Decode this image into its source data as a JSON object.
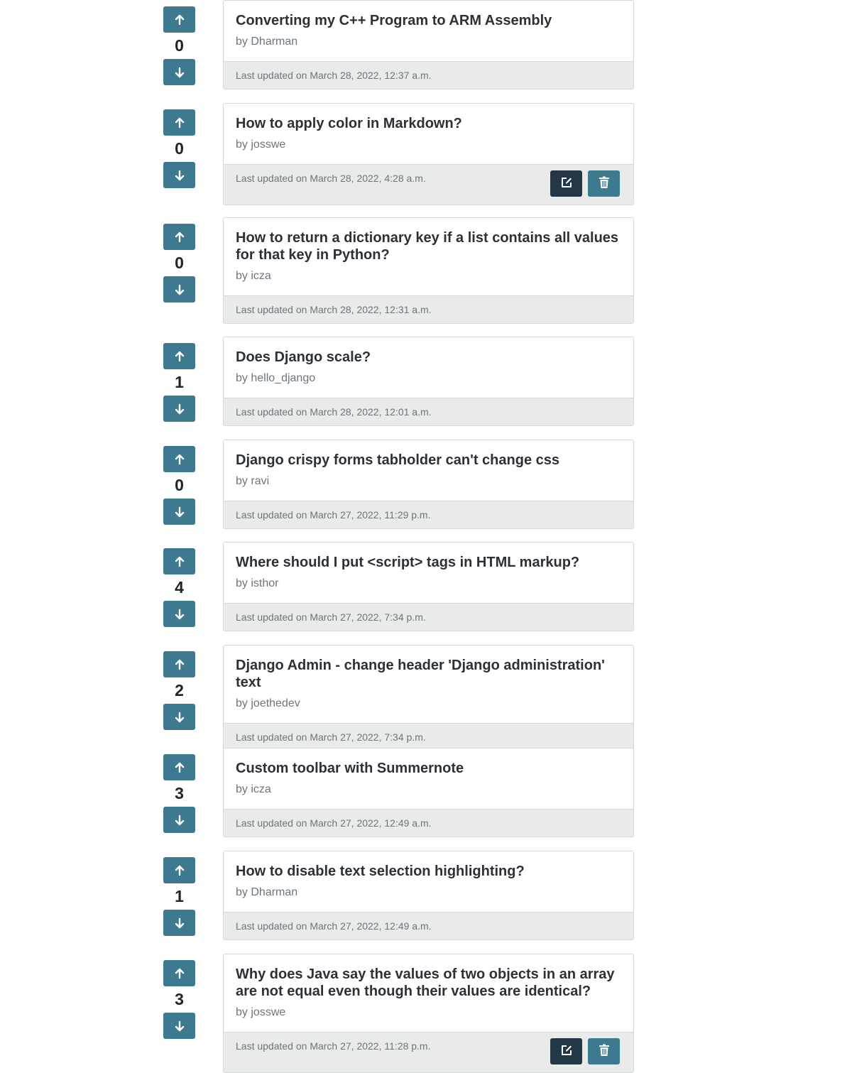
{
  "labels": {
    "author_prefix": "by",
    "updated_prefix": "Last updated on"
  },
  "colors": {
    "vote_button": "#3e7a8f",
    "edit_button": "#243746",
    "delete_button": "#3e7a8f",
    "card_footer": "#e8ebea"
  },
  "icons": {
    "upvote": "arrow-up-icon",
    "downvote": "arrow-down-icon",
    "edit": "edit-icon",
    "delete": "trash-icon"
  },
  "questions": [
    {
      "title": "Converting my C++ Program to ARM Assembly",
      "author": "Dharman",
      "updated": "March 28, 2022, 12:37 a.m.",
      "votes": "0",
      "owner": false
    },
    {
      "title": "How to apply color in Markdown?",
      "author": "josswe",
      "updated": "March 28, 2022, 4:28 a.m.",
      "votes": "0",
      "owner": true
    },
    {
      "title": "How to return a dictionary key if a list contains all values for that key in Python?",
      "author": "icza",
      "updated": "March 28, 2022, 12:31 a.m.",
      "votes": "0",
      "owner": false
    },
    {
      "title": "Does Django scale?",
      "author": "hello_django",
      "updated": "March 28, 2022, 12:01 a.m.",
      "votes": "1",
      "owner": false
    },
    {
      "title": "Django crispy forms tabholder can't change css",
      "author": "ravi",
      "updated": "March 27, 2022, 11:29 p.m.",
      "votes": "0",
      "owner": false
    },
    {
      "title": "Where should I put <script> tags in HTML markup?",
      "author": "isthor",
      "updated": "March 27, 2022, 7:34 p.m.",
      "votes": "4",
      "owner": false
    },
    {
      "title": "Django Admin - change header 'Django administration' text",
      "author": "joethedev",
      "updated": "March 27, 2022, 7:34 p.m.",
      "votes": "2",
      "owner": false
    },
    {
      "title": "Custom toolbar with Summernote",
      "author": "icza",
      "updated": "March 27, 2022, 12:49 a.m.",
      "votes": "3",
      "owner": false
    },
    {
      "title": "How to disable text selection highlighting?",
      "author": "Dharman",
      "updated": "March 27, 2022, 12:49 a.m.",
      "votes": "1",
      "owner": false
    },
    {
      "title": "Why does Java say the values of two objects in an array are not equal even though their values are identical?",
      "author": "josswe",
      "updated": "March 27, 2022, 11:28 p.m.",
      "votes": "3",
      "owner": true
    }
  ]
}
